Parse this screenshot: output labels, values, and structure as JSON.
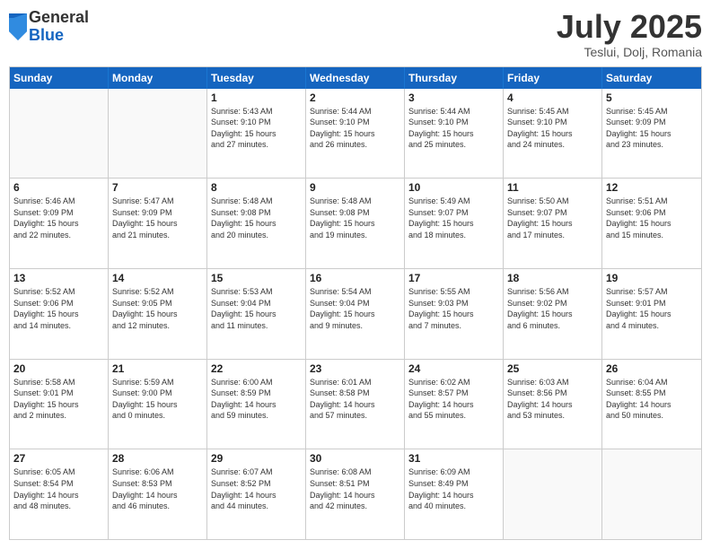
{
  "logo": {
    "general": "General",
    "blue": "Blue"
  },
  "title": "July 2025",
  "subtitle": "Teslui, Dolj, Romania",
  "header_days": [
    "Sunday",
    "Monday",
    "Tuesday",
    "Wednesday",
    "Thursday",
    "Friday",
    "Saturday"
  ],
  "weeks": [
    [
      {
        "day": "",
        "info": ""
      },
      {
        "day": "",
        "info": ""
      },
      {
        "day": "1",
        "info": "Sunrise: 5:43 AM\nSunset: 9:10 PM\nDaylight: 15 hours\nand 27 minutes."
      },
      {
        "day": "2",
        "info": "Sunrise: 5:44 AM\nSunset: 9:10 PM\nDaylight: 15 hours\nand 26 minutes."
      },
      {
        "day": "3",
        "info": "Sunrise: 5:44 AM\nSunset: 9:10 PM\nDaylight: 15 hours\nand 25 minutes."
      },
      {
        "day": "4",
        "info": "Sunrise: 5:45 AM\nSunset: 9:10 PM\nDaylight: 15 hours\nand 24 minutes."
      },
      {
        "day": "5",
        "info": "Sunrise: 5:45 AM\nSunset: 9:09 PM\nDaylight: 15 hours\nand 23 minutes."
      }
    ],
    [
      {
        "day": "6",
        "info": "Sunrise: 5:46 AM\nSunset: 9:09 PM\nDaylight: 15 hours\nand 22 minutes."
      },
      {
        "day": "7",
        "info": "Sunrise: 5:47 AM\nSunset: 9:09 PM\nDaylight: 15 hours\nand 21 minutes."
      },
      {
        "day": "8",
        "info": "Sunrise: 5:48 AM\nSunset: 9:08 PM\nDaylight: 15 hours\nand 20 minutes."
      },
      {
        "day": "9",
        "info": "Sunrise: 5:48 AM\nSunset: 9:08 PM\nDaylight: 15 hours\nand 19 minutes."
      },
      {
        "day": "10",
        "info": "Sunrise: 5:49 AM\nSunset: 9:07 PM\nDaylight: 15 hours\nand 18 minutes."
      },
      {
        "day": "11",
        "info": "Sunrise: 5:50 AM\nSunset: 9:07 PM\nDaylight: 15 hours\nand 17 minutes."
      },
      {
        "day": "12",
        "info": "Sunrise: 5:51 AM\nSunset: 9:06 PM\nDaylight: 15 hours\nand 15 minutes."
      }
    ],
    [
      {
        "day": "13",
        "info": "Sunrise: 5:52 AM\nSunset: 9:06 PM\nDaylight: 15 hours\nand 14 minutes."
      },
      {
        "day": "14",
        "info": "Sunrise: 5:52 AM\nSunset: 9:05 PM\nDaylight: 15 hours\nand 12 minutes."
      },
      {
        "day": "15",
        "info": "Sunrise: 5:53 AM\nSunset: 9:04 PM\nDaylight: 15 hours\nand 11 minutes."
      },
      {
        "day": "16",
        "info": "Sunrise: 5:54 AM\nSunset: 9:04 PM\nDaylight: 15 hours\nand 9 minutes."
      },
      {
        "day": "17",
        "info": "Sunrise: 5:55 AM\nSunset: 9:03 PM\nDaylight: 15 hours\nand 7 minutes."
      },
      {
        "day": "18",
        "info": "Sunrise: 5:56 AM\nSunset: 9:02 PM\nDaylight: 15 hours\nand 6 minutes."
      },
      {
        "day": "19",
        "info": "Sunrise: 5:57 AM\nSunset: 9:01 PM\nDaylight: 15 hours\nand 4 minutes."
      }
    ],
    [
      {
        "day": "20",
        "info": "Sunrise: 5:58 AM\nSunset: 9:01 PM\nDaylight: 15 hours\nand 2 minutes."
      },
      {
        "day": "21",
        "info": "Sunrise: 5:59 AM\nSunset: 9:00 PM\nDaylight: 15 hours\nand 0 minutes."
      },
      {
        "day": "22",
        "info": "Sunrise: 6:00 AM\nSunset: 8:59 PM\nDaylight: 14 hours\nand 59 minutes."
      },
      {
        "day": "23",
        "info": "Sunrise: 6:01 AM\nSunset: 8:58 PM\nDaylight: 14 hours\nand 57 minutes."
      },
      {
        "day": "24",
        "info": "Sunrise: 6:02 AM\nSunset: 8:57 PM\nDaylight: 14 hours\nand 55 minutes."
      },
      {
        "day": "25",
        "info": "Sunrise: 6:03 AM\nSunset: 8:56 PM\nDaylight: 14 hours\nand 53 minutes."
      },
      {
        "day": "26",
        "info": "Sunrise: 6:04 AM\nSunset: 8:55 PM\nDaylight: 14 hours\nand 50 minutes."
      }
    ],
    [
      {
        "day": "27",
        "info": "Sunrise: 6:05 AM\nSunset: 8:54 PM\nDaylight: 14 hours\nand 48 minutes."
      },
      {
        "day": "28",
        "info": "Sunrise: 6:06 AM\nSunset: 8:53 PM\nDaylight: 14 hours\nand 46 minutes."
      },
      {
        "day": "29",
        "info": "Sunrise: 6:07 AM\nSunset: 8:52 PM\nDaylight: 14 hours\nand 44 minutes."
      },
      {
        "day": "30",
        "info": "Sunrise: 6:08 AM\nSunset: 8:51 PM\nDaylight: 14 hours\nand 42 minutes."
      },
      {
        "day": "31",
        "info": "Sunrise: 6:09 AM\nSunset: 8:49 PM\nDaylight: 14 hours\nand 40 minutes."
      },
      {
        "day": "",
        "info": ""
      },
      {
        "day": "",
        "info": ""
      }
    ]
  ]
}
